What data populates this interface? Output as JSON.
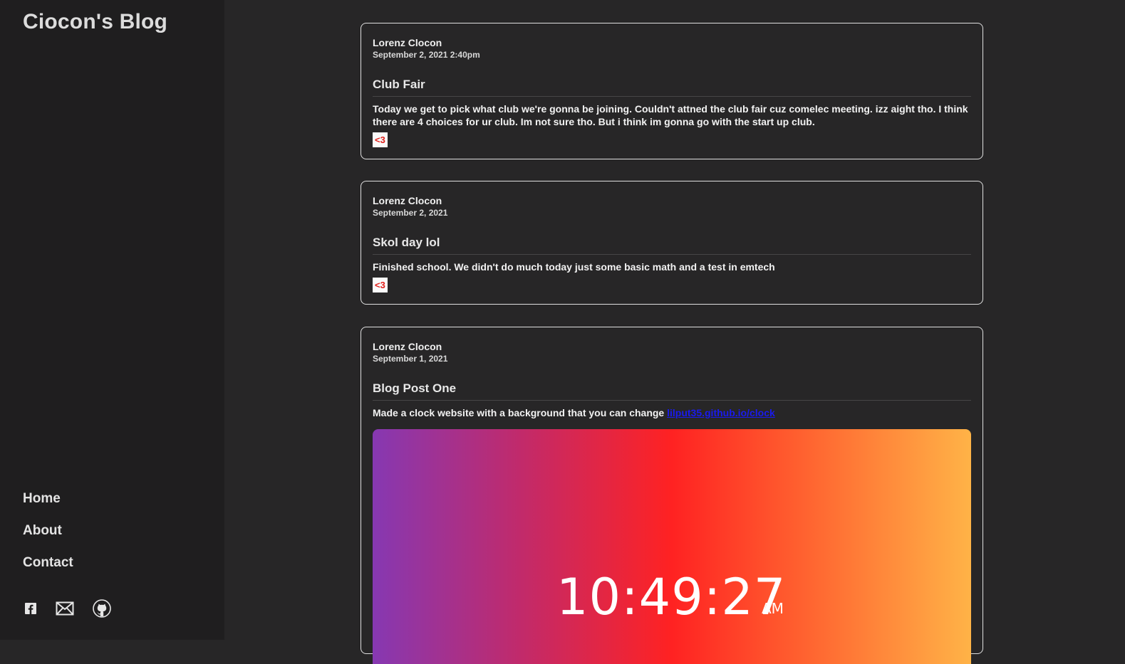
{
  "sidebar": {
    "title": "Ciocon's Blog",
    "nav": [
      {
        "label": "Home"
      },
      {
        "label": "About"
      },
      {
        "label": "Contact"
      }
    ],
    "social_icons": [
      "facebook-icon",
      "mail-icon",
      "github-icon"
    ]
  },
  "posts": [
    {
      "author": "Lorenz Clocon",
      "date": "September 2, 2021 2:40pm",
      "title": "Club Fair",
      "body": "Today we get to pick what club we're gonna be joining. Couldn't attned the club fair cuz comelec meeting. izz aight tho. I think there are 4 choices for ur club. Im not sure tho. But i think im gonna go with the start up club.",
      "heart": "<3"
    },
    {
      "author": "Lorenz Clocon",
      "date": "September 2, 2021",
      "title": "Skol day lol",
      "body": "Finished school. We didn't do much today just some basic math and a test in emtech",
      "heart": "<3"
    },
    {
      "author": "Lorenz Clocon",
      "date": "September 1, 2021",
      "title": "Blog Post One",
      "body": "Made a clock website with a background that you can change",
      "link": "lilput35.github.io/clock",
      "clock_time": "10:49:27",
      "clock_ampm": "AM"
    }
  ],
  "colors": {
    "sidebar_bg": "#1f1e1f",
    "main_bg": "#272627",
    "link": "#1a1aee",
    "heart": "#e0201c"
  }
}
